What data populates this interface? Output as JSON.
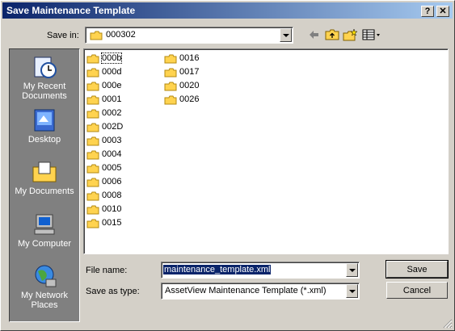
{
  "window": {
    "title": "Save Maintenance Template"
  },
  "title_buttons": {
    "help": "?",
    "close": "✕"
  },
  "save_in": {
    "label": "Save in:",
    "value": "000302"
  },
  "places": [
    {
      "label": "My Recent Documents",
      "icon": "recent-documents-icon"
    },
    {
      "label": "Desktop",
      "icon": "desktop-icon"
    },
    {
      "label": "My Documents",
      "icon": "my-documents-icon"
    },
    {
      "label": "My Computer",
      "icon": "my-computer-icon"
    },
    {
      "label": "My Network Places",
      "icon": "network-places-icon"
    }
  ],
  "folders_col1": [
    "000b",
    "000d",
    "000e",
    "0001",
    "0002",
    "002D",
    "0003",
    "0004",
    "0005",
    "0006",
    "0008",
    "0010",
    "0015"
  ],
  "folders_col2": [
    "0016",
    "0017",
    "0020",
    "0026"
  ],
  "file_name": {
    "label": "File name:",
    "value": "maintenance_template.xml"
  },
  "save_as_type": {
    "label": "Save as type:",
    "value": "AssetView Maintenance Template (*.xml)"
  },
  "buttons": {
    "save": "Save",
    "cancel": "Cancel"
  }
}
